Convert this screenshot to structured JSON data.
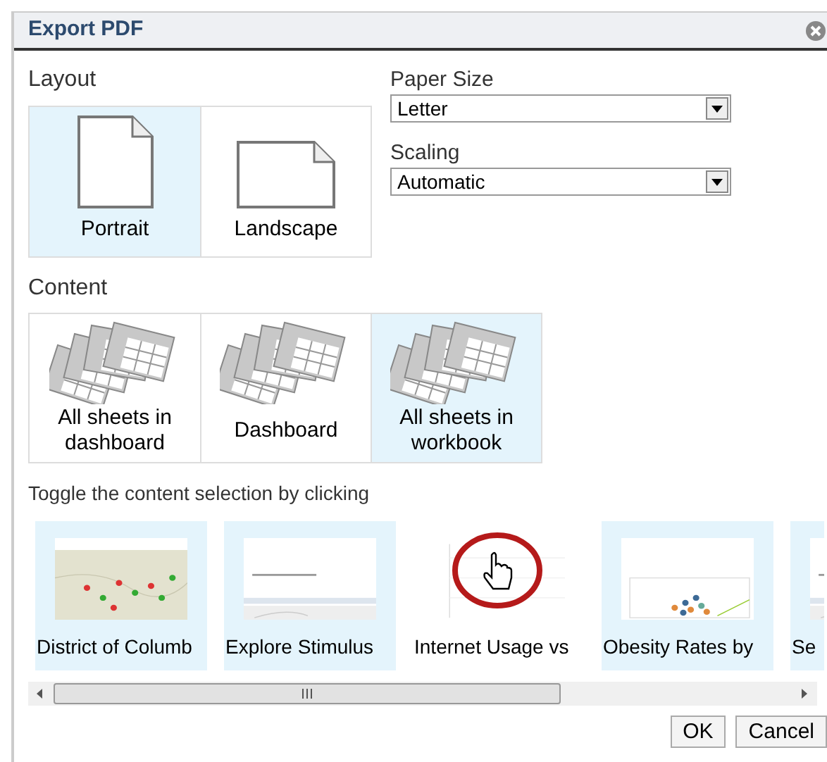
{
  "window": {
    "title": "Export PDF"
  },
  "layout": {
    "label": "Layout",
    "options": [
      {
        "kind": "portrait",
        "label": "Portrait",
        "selected": true
      },
      {
        "kind": "landscape",
        "label": "Landscape",
        "selected": false
      }
    ]
  },
  "paper_size": {
    "label": "Paper Size",
    "value": "Letter"
  },
  "scaling": {
    "label": "Scaling",
    "value": "Automatic"
  },
  "content": {
    "label": "Content",
    "options": [
      {
        "label": "All sheets in dashboard",
        "selected": false
      },
      {
        "label": "Dashboard",
        "selected": false
      },
      {
        "label": "All sheets in workbook",
        "selected": true
      }
    ]
  },
  "sheets": {
    "hint": "Toggle the content selection by clicking",
    "items": [
      {
        "kind": "map",
        "label": "District of Columb",
        "selected": true
      },
      {
        "kind": "form",
        "label": "Explore Stimulus",
        "selected": true
      },
      {
        "kind": "line",
        "label": "Internet Usage vs",
        "selected": false
      },
      {
        "kind": "scatter",
        "label": "Obesity Rates by",
        "selected": true
      },
      {
        "kind": "form",
        "label": "Se",
        "selected": true
      }
    ]
  },
  "buttons": [
    "OK",
    "Cancel"
  ]
}
